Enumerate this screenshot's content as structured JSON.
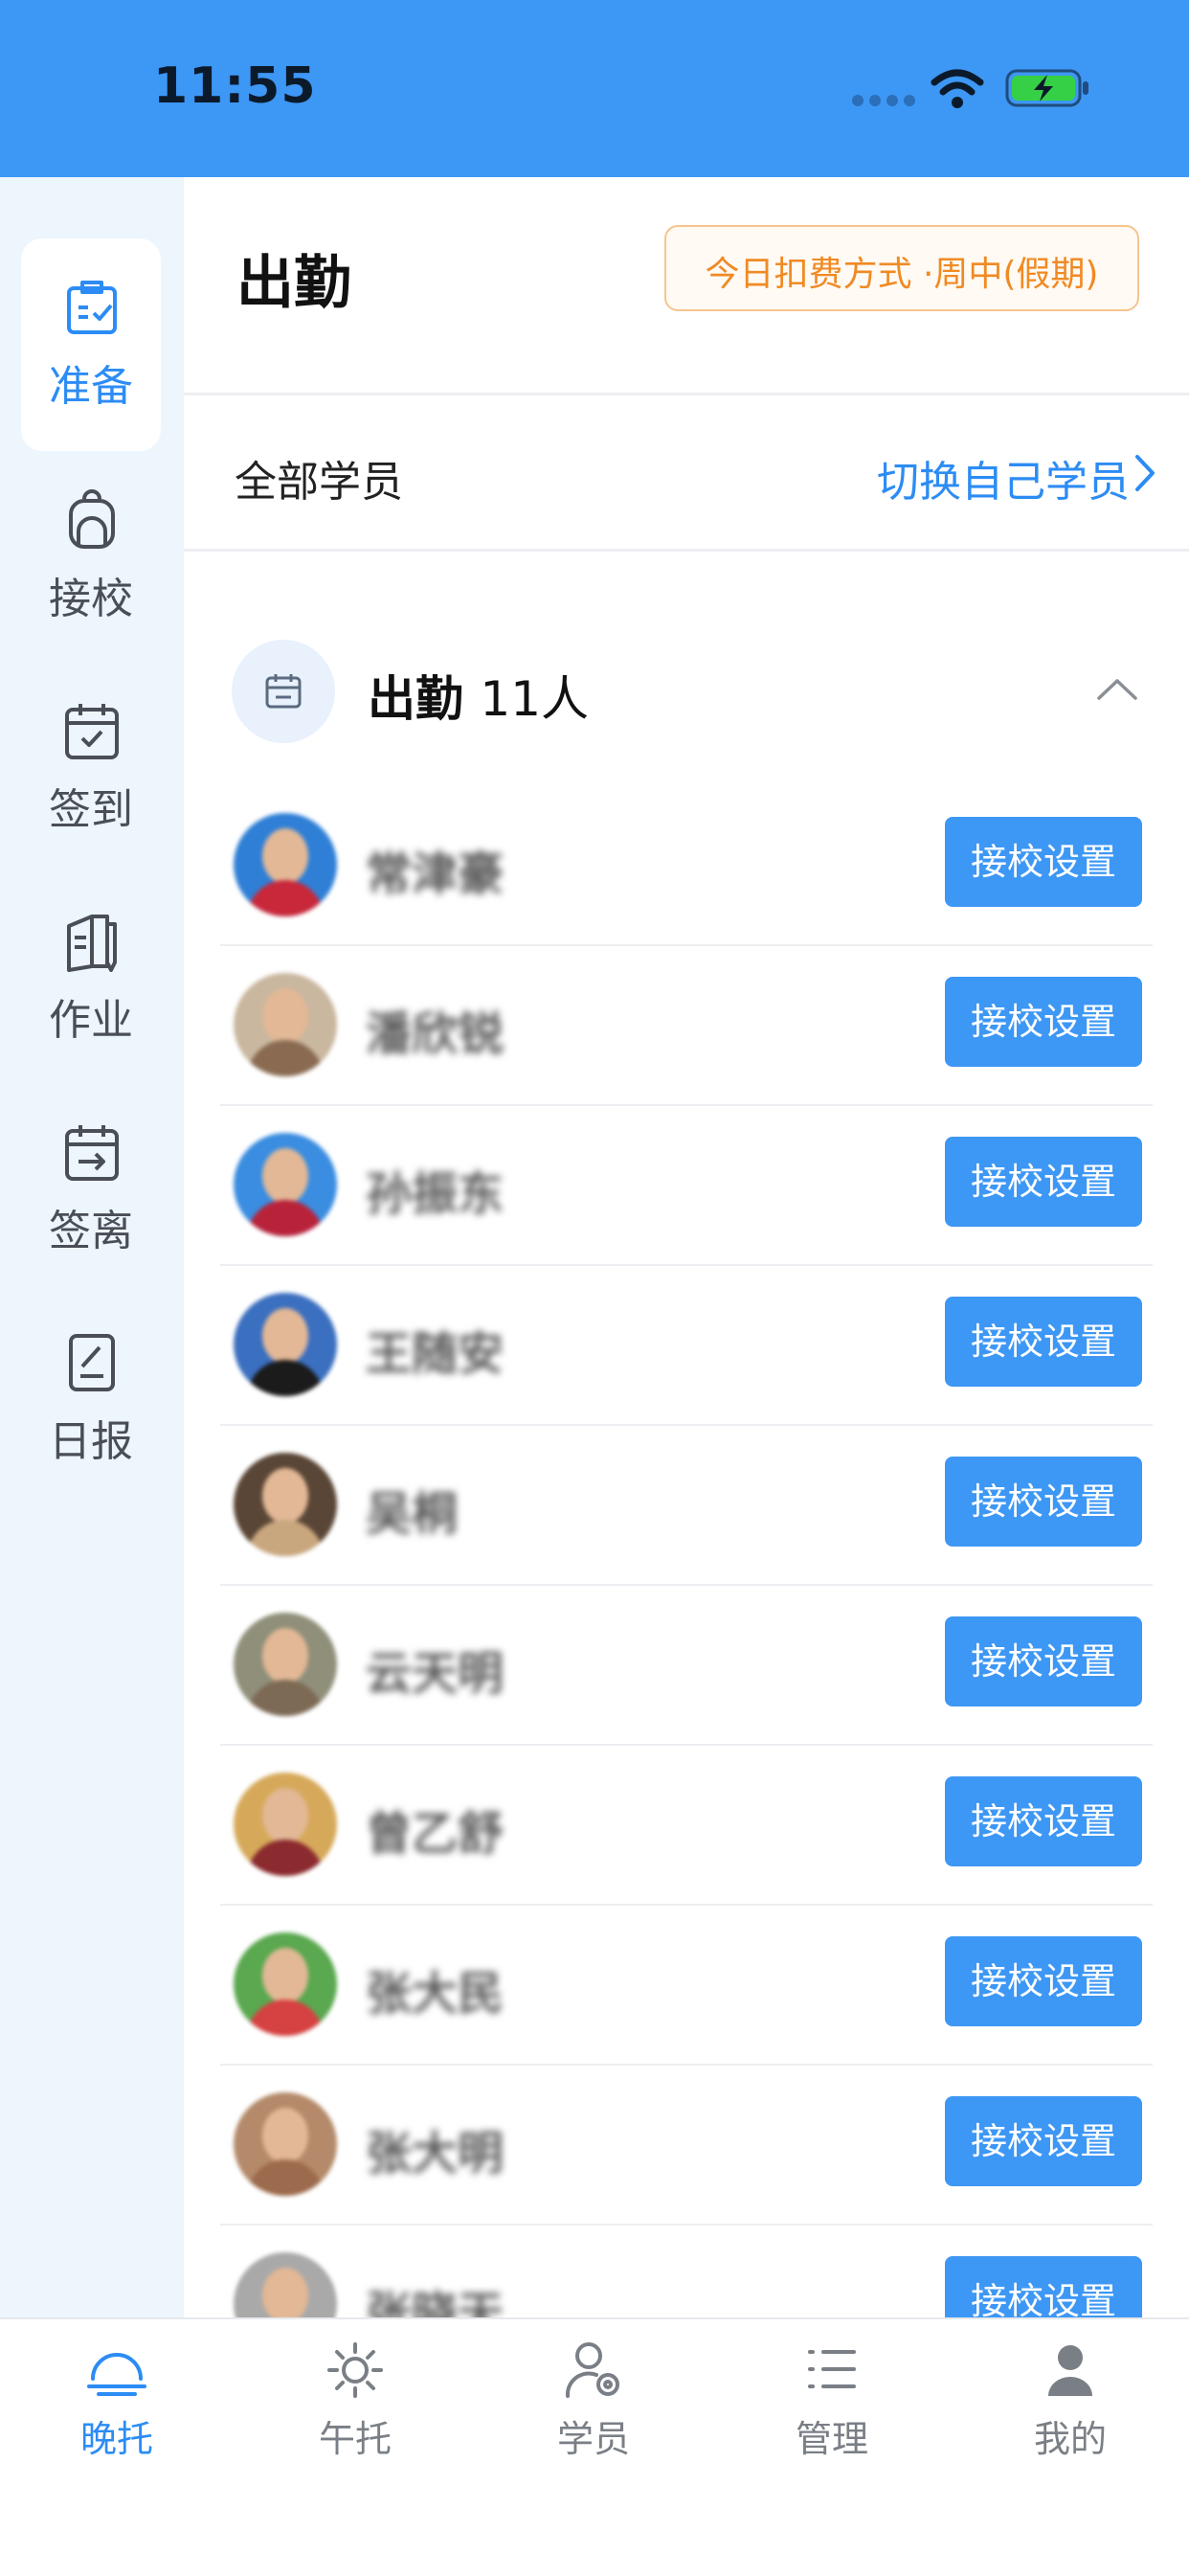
{
  "status_bar": {
    "time": "11:55"
  },
  "sidebar": {
    "items": [
      {
        "label": "准备",
        "icon": "clipboard-check-icon",
        "active": true
      },
      {
        "label": "接校",
        "icon": "backpack-icon",
        "active": false
      },
      {
        "label": "签到",
        "icon": "calendar-check-icon",
        "active": false
      },
      {
        "label": "作业",
        "icon": "homework-book-icon",
        "active": false
      },
      {
        "label": "签离",
        "icon": "calendar-exit-icon",
        "active": false
      },
      {
        "label": "日报",
        "icon": "report-icon",
        "active": false
      }
    ]
  },
  "header": {
    "title": "出勤",
    "fee_mode": "今日扣费方式 ·周中(假期)"
  },
  "filter": {
    "label": "全部学员",
    "switch_label": "切换自己学员"
  },
  "attendance": {
    "title": "出勤",
    "count": "11人"
  },
  "students": [
    {
      "name": "常津豪",
      "button": "接校设置",
      "shirt": "#c8283a",
      "bg": "#2f7fd6"
    },
    {
      "name": "潘欣锐",
      "button": "接校设置",
      "shirt": "#8a6b52",
      "bg": "#c9b79f"
    },
    {
      "name": "孙振东",
      "button": "接校设置",
      "shirt": "#b8233a",
      "bg": "#3a8de0"
    },
    {
      "name": "王随安",
      "button": "接校设置",
      "shirt": "#1b1b1b",
      "bg": "#3b6fbf"
    },
    {
      "name": "吴桐",
      "button": "接校设置",
      "shirt": "#c9a77e",
      "bg": "#5a4636"
    },
    {
      "name": "云天明",
      "button": "接校设置",
      "shirt": "#7d6a55",
      "bg": "#8f8f7a"
    },
    {
      "name": "曾乙舒",
      "button": "接校设置",
      "shirt": "#8b2a2f",
      "bg": "#d6a95a"
    },
    {
      "name": "张大民",
      "button": "接校设置",
      "shirt": "#d64141",
      "bg": "#5aa84f"
    },
    {
      "name": "张大明",
      "button": "接校设置",
      "shirt": "#9c6a4c",
      "bg": "#b48a6a"
    },
    {
      "name": "张晓天",
      "button": "接校设置",
      "shirt": "#e0d6cc",
      "bg": "#a9a9a9"
    }
  ],
  "tabbar": {
    "items": [
      {
        "label": "晚托",
        "icon": "evening-icon",
        "active": true
      },
      {
        "label": "午托",
        "icon": "sun-icon",
        "active": false
      },
      {
        "label": "学员",
        "icon": "student-settings-icon",
        "active": false
      },
      {
        "label": "管理",
        "icon": "list-icon",
        "active": false
      },
      {
        "label": "我的",
        "icon": "profile-icon",
        "active": false
      }
    ]
  },
  "colors": {
    "accent": "#3d97f5",
    "fee_orange": "#f08a24",
    "sidebar_bg": "#edf5fd"
  }
}
